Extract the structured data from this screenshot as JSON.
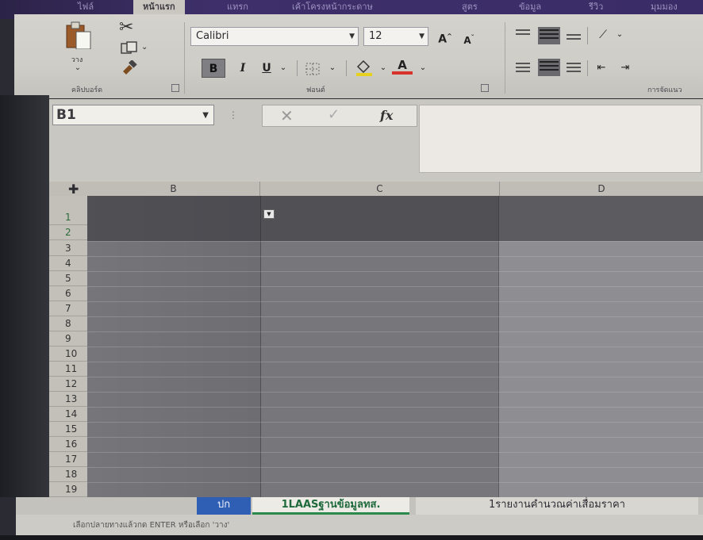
{
  "tabs": [
    {
      "label": "ไฟล์"
    },
    {
      "label": "หน้าแรก"
    },
    {
      "label": "แทรก"
    },
    {
      "label": "เค้าโครงหน้ากระดาษ"
    },
    {
      "label": "สูตร"
    },
    {
      "label": "ข้อมูล"
    },
    {
      "label": "รีวิว"
    },
    {
      "label": "มุมมอง"
    }
  ],
  "ribbon": {
    "clipboard": {
      "paste_label": "วาง",
      "group_label": "คลิปบอร์ด"
    },
    "font": {
      "name": "Calibri",
      "size": "12",
      "group_label": "ฟอนต์",
      "bold": "B",
      "italic": "I",
      "underline": "U"
    },
    "alignment": {
      "group_label": "การจัดแนว"
    }
  },
  "formula_bar": {
    "name_box": "B1",
    "formula": ""
  },
  "columns": [
    "B",
    "C",
    "D"
  ],
  "rows": [
    "1",
    "2",
    "3",
    "4",
    "5",
    "6",
    "7",
    "8",
    "9",
    "10",
    "11",
    "12",
    "13",
    "14",
    "15",
    "16",
    "17",
    "18",
    "19"
  ],
  "sheets": [
    {
      "label": "ปก"
    },
    {
      "label": "1LAASฐานข้อมูลทส."
    },
    {
      "label": "1รายงานคำนวณค่าเสื่อมราคา"
    }
  ],
  "status": "เลือกปลายทางแล้วกด ENTER หรือเลือก 'วาง'",
  "colors": {
    "ribbon_bg": "#cfcdc7",
    "tab_bar": "#3a2c66",
    "active_sheet_green": "#2c8a4c",
    "first_sheet_blue": "#2e5fb5"
  }
}
